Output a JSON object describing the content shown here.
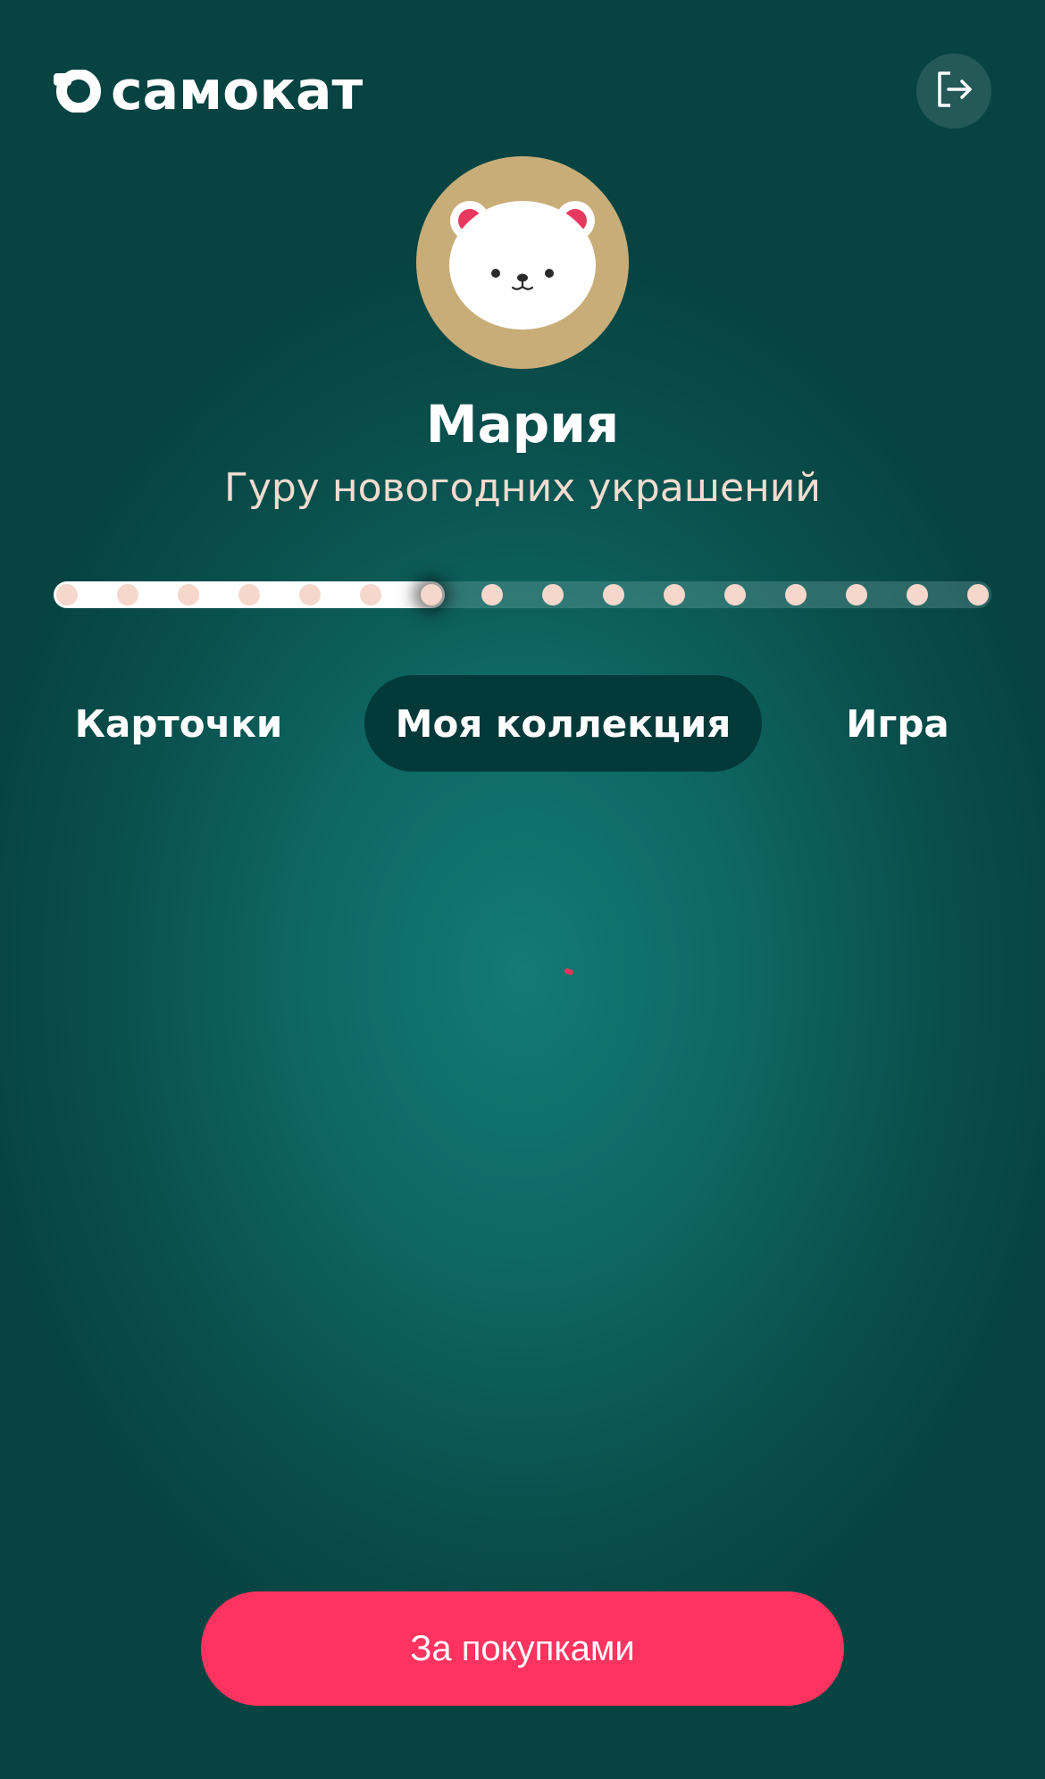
{
  "app": {
    "brand": "самокат",
    "logo_icon": "samokat-logo-icon",
    "logout_icon": "logout-icon"
  },
  "profile": {
    "name": "Мария",
    "title": "Гуру новогодних украшений",
    "avatar_icon": "polar-bear-avatar",
    "avatar_bg": "#c8ad78"
  },
  "progress": {
    "total_steps": 16,
    "current_step": 7,
    "fill_color": "#ffffff",
    "dot_color": "#f6d7cc"
  },
  "tabs": [
    {
      "label": "Карточки",
      "active": false
    },
    {
      "label": "Моя коллекция",
      "active": true
    },
    {
      "label": "Игра",
      "active": false
    }
  ],
  "cta": {
    "label": "За покупками",
    "color": "#ff335f"
  },
  "colors": {
    "background": "#0e6763",
    "active_tab": "#04393a"
  }
}
